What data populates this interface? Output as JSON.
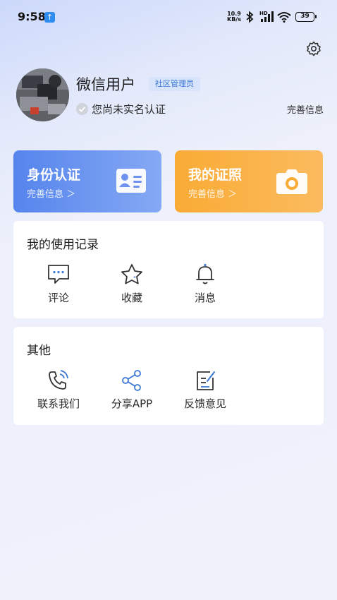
{
  "status_bar": {
    "time": "9:58",
    "network_speed_value": "10.9",
    "network_speed_unit": "KB/s",
    "signal_label": "HD",
    "battery": "39"
  },
  "profile": {
    "name": "微信用户",
    "role": "社区管理员",
    "verify_status": "您尚未实名认证",
    "complete_info": "完善信息"
  },
  "cards": {
    "identity": {
      "title": "身份认证",
      "subtitle": "完善信息 ＞"
    },
    "license": {
      "title": "我的证照",
      "subtitle": "完善信息 ＞"
    }
  },
  "records": {
    "title": "我的使用记录",
    "items": [
      {
        "label": "评论",
        "icon": "comment-icon"
      },
      {
        "label": "收藏",
        "icon": "star-icon"
      },
      {
        "label": "消息",
        "icon": "bell-icon"
      }
    ]
  },
  "other": {
    "title": "其他",
    "items": [
      {
        "label": "联系我们",
        "icon": "phone-icon"
      },
      {
        "label": "分享APP",
        "icon": "share-icon"
      },
      {
        "label": "反馈意见",
        "icon": "feedback-icon"
      }
    ]
  },
  "colors": {
    "accent_blue": "#3c76d3",
    "card_blue": "#5584ec",
    "card_orange": "#f9ab35"
  }
}
